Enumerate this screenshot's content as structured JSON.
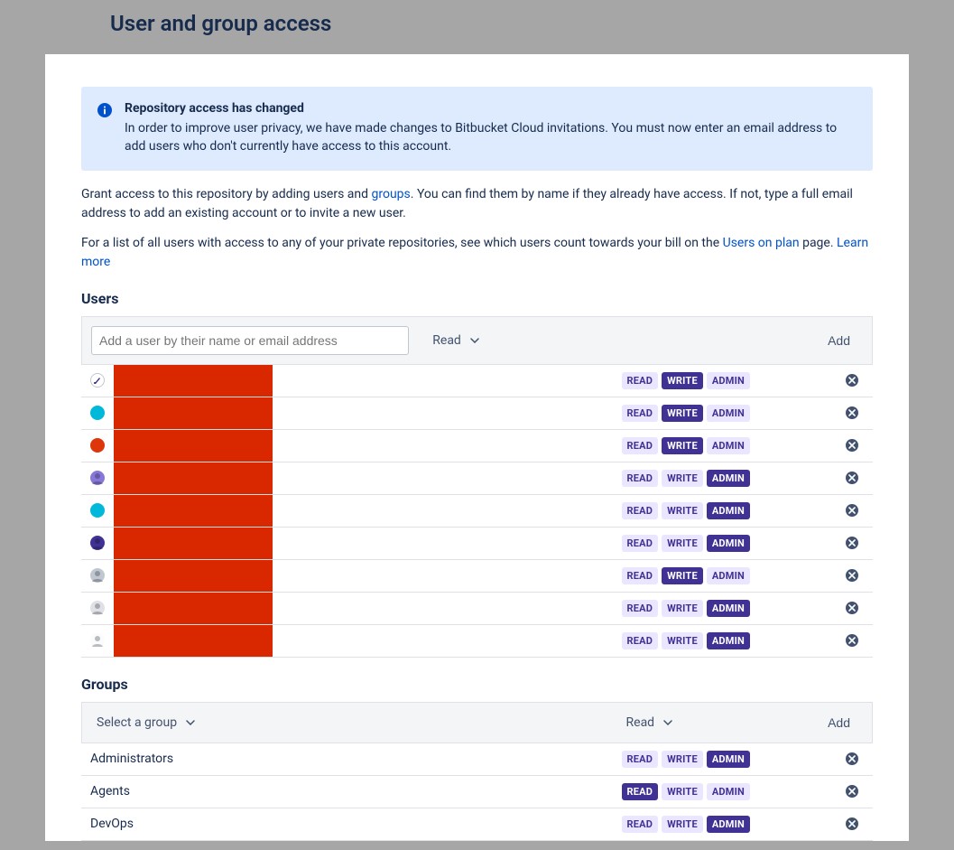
{
  "page_title": "User and group access",
  "info": {
    "title": "Repository access has changed",
    "text": "In order to improve user privacy, we have made changes to Bitbucket Cloud invitations. You must now enter an email address to add users who don't currently have access to this account."
  },
  "desc": {
    "p1_a": "Grant access to this repository by adding users and ",
    "p1_link": "groups",
    "p1_b": ". You can find them by name if they already have access. If not, type a full email address to add an existing account or to invite a new user.",
    "p2_a": "For a list of all users with access to any of your private repositories, see which users count towards your bill on the ",
    "p2_link": "Users on plan",
    "p2_b": " page. ",
    "learn_more": "Learn more"
  },
  "labels": {
    "users_heading": "Users",
    "groups_heading": "Groups",
    "read": "READ",
    "write": "WRITE",
    "admin": "ADMIN",
    "add": "Add",
    "read_dropdown": "Read",
    "select_group": "Select a group",
    "user_input_placeholder": "Add a user by their name or email address"
  },
  "users": [
    {
      "avatar_bg": "#ffffff",
      "avatar_style": "icon",
      "perm": "write"
    },
    {
      "avatar_bg": "#00b8d9",
      "avatar_style": "init",
      "perm": "write"
    },
    {
      "avatar_bg": "#de350b",
      "avatar_style": "init",
      "perm": "write"
    },
    {
      "avatar_bg": "#8777d9",
      "avatar_style": "photo",
      "perm": "admin"
    },
    {
      "avatar_bg": "#00b8d9",
      "avatar_style": "init",
      "perm": "admin"
    },
    {
      "avatar_bg": "#403294",
      "avatar_style": "photo",
      "perm": "admin"
    },
    {
      "avatar_bg": "#c1c7d0",
      "avatar_style": "photo",
      "perm": "write"
    },
    {
      "avatar_bg": "#dfe1e6",
      "avatar_style": "photo",
      "perm": "admin"
    },
    {
      "avatar_bg": "#fafbfc",
      "avatar_style": "photo",
      "perm": "admin"
    }
  ],
  "groups": [
    {
      "name": "Administrators",
      "perm": "admin"
    },
    {
      "name": "Agents",
      "perm": "read"
    },
    {
      "name": "DevOps",
      "perm": "admin"
    }
  ]
}
